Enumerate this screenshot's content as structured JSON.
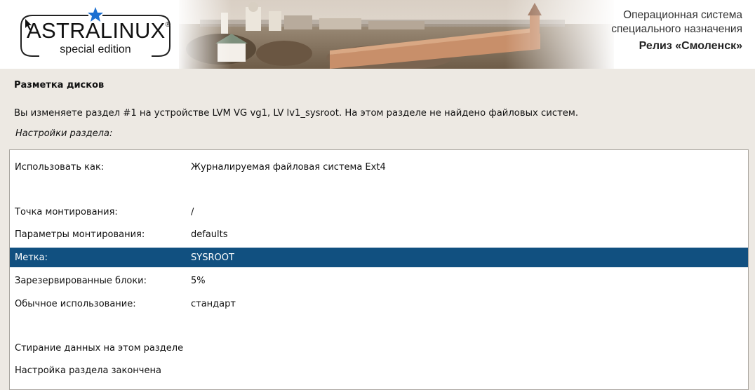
{
  "header": {
    "logo_text": "ASTRALINUX",
    "logo_registered": "®",
    "logo_sub": "special edition",
    "line1": "Операционная система",
    "line2": "специального назначения",
    "release": "Релиз «Смоленск»"
  },
  "page": {
    "title": "Разметка дисков",
    "description": "Вы изменяете раздел #1 на устройстве LVM VG vg1, LV lv1_sysroot. На этом разделе не найдено файловых систем.",
    "subtitle": "Настройки раздела:"
  },
  "settings": [
    {
      "key": "Использовать как:",
      "value": "Журналируемая файловая система Ext4",
      "selected": false
    },
    {
      "key": "Точка монтирования:",
      "value": "/",
      "selected": false
    },
    {
      "key": "Параметры монтирования:",
      "value": "defaults",
      "selected": false
    },
    {
      "key": "Метка:",
      "value": "SYSROOT",
      "selected": true
    },
    {
      "key": "Зарезервированные блоки:",
      "value": "5%",
      "selected": false
    },
    {
      "key": "Обычное использование:",
      "value": "стандарт",
      "selected": false
    },
    {
      "key": "Стирание данных на этом разделе",
      "value": "",
      "selected": false
    },
    {
      "key": "Настройка раздела закончена",
      "value": "",
      "selected": false
    }
  ],
  "colors": {
    "selection": "#115080",
    "background": "#ede9e3",
    "star": "#1c6fd1"
  }
}
